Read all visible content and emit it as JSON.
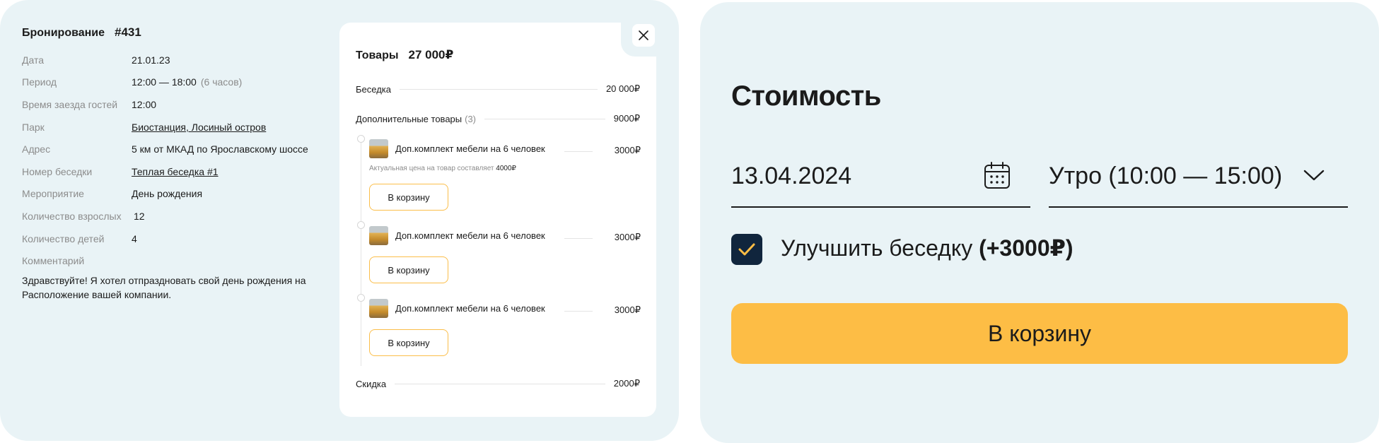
{
  "booking": {
    "title": "Бронирование",
    "number": "#431",
    "fields": [
      {
        "label": "Дата",
        "value": "21.01.23"
      },
      {
        "label": "Период",
        "value": "12:00 — 18:00",
        "extra": "(6 часов)"
      },
      {
        "label": "Время заезда гостей",
        "value": "12:00"
      },
      {
        "label": "Парк",
        "value": "Биостанция, Лосиный остров"
      },
      {
        "label": "Адрес",
        "value": "5 км от МКАД по Ярославскому шоссе"
      },
      {
        "label": "Номер беседки",
        "value": "Теплая беседка #1"
      },
      {
        "label": "Мероприятие",
        "value": "День рождения"
      },
      {
        "label": "Количество взрослых",
        "value": "12"
      },
      {
        "label": "Количество детей",
        "value": "4"
      },
      {
        "label": "Комментарий",
        "value": ""
      }
    ],
    "comment": "Здравствуйте! Я хотел отпраздновать свой день рождения на Расположение вашей компании."
  },
  "cart": {
    "title": "Товары",
    "total": "27 000₽",
    "gazebo_label": "Беседка",
    "gazebo_price": "20 000₽",
    "extras_label": "Дополнительные товары",
    "extras_count": "(3)",
    "extras_price": "9000₽",
    "items": [
      {
        "name": "Доп.комплект мебели на 6 человек",
        "price": "3000₽",
        "note": "Актуальная цена на товар составляет",
        "note_price": "4000₽",
        "button": "В корзину"
      },
      {
        "name": "Доп.комплект мебели на 6 человек",
        "price": "3000₽",
        "button": "В корзину"
      },
      {
        "name": "Доп.комплект мебели на 6 человек",
        "price": "3000₽",
        "button": "В корзину"
      }
    ],
    "discount_label": "Скидка",
    "discount_price": "2000₽"
  },
  "pricing": {
    "title": "Стоимость",
    "date": "13.04.2024",
    "time_slot": "Утро (10:00 — 15:00)",
    "upgrade_label": "Улучшить беседку",
    "upgrade_price": "(+3000₽)",
    "upgrade_checked": true,
    "button": "В корзину"
  },
  "colors": {
    "panel_bg": "#e9f3f6",
    "accent": "#fdbd45",
    "checkbox_bg": "#10253d"
  }
}
